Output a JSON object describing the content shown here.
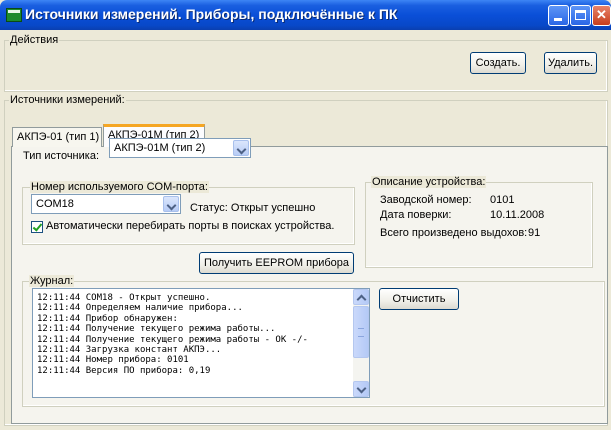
{
  "window": {
    "title": "Источники измерений. Приборы, подключённые к ПК"
  },
  "actions": {
    "legend": "Действия",
    "create_label": "Создать.",
    "delete_label": "Удалить."
  },
  "sources": {
    "legend": "Источники измерений:",
    "tabs": [
      {
        "label": "АКПЭ-01 (тип 1)"
      },
      {
        "label": "АКПЭ-01М (тип 2)"
      }
    ],
    "source_type_label": "Тип источника:",
    "source_type_value": "АКПЭ-01М (тип 2)"
  },
  "com_port": {
    "legend": "Номер используемого COM-порта:",
    "value": "COM18",
    "status": "Статус: Открыт успешно",
    "auto_scan_label": "Автоматически перебирать порты в поисках устройства."
  },
  "device": {
    "legend": "Описание устройства:",
    "serial_label": "Заводской номер:",
    "serial_value": "0101",
    "verify_label": "Дата поверки:",
    "verify_value": "10.11.2008",
    "exhales_label": "Всего произведено выдохов:",
    "exhales_value": "91"
  },
  "eeprom_button": "Получить EEPROM прибора",
  "journal": {
    "legend": "Журнал:",
    "clear_label": "Отчистить",
    "lines": [
      "12:11:44  COM18 - Открыт успешно.",
      "12:11:44  Определяем наличие прибора...",
      "12:11:44  Прибор обнаружен:",
      "12:11:44  Получение текущего режима работы...",
      "12:11:44  Получение текущего режима работы - OK   -/-",
      "12:11:44  Загрузка констант АКПЭ...",
      "12:11:44  Номер прибора: 0101",
      "12:11:44  Версия ПО прибора: 0,19"
    ]
  }
}
